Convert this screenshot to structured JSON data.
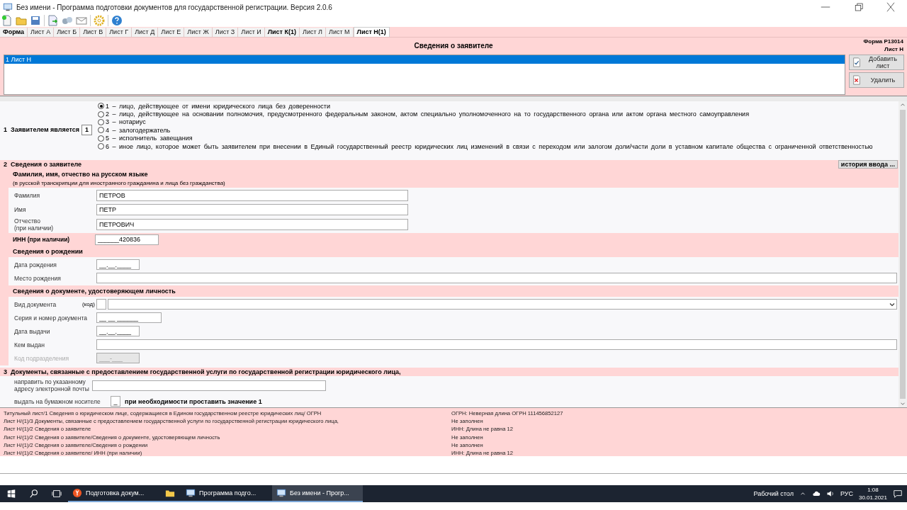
{
  "window": {
    "title": "Без имени - Программа подготовки документов для государственной регистрации. Версия 2.0.6"
  },
  "tabs": [
    {
      "label": "Форма",
      "bold": true,
      "selected": false
    },
    {
      "label": "Лист А",
      "bold": false,
      "selected": false
    },
    {
      "label": "Лист Б",
      "bold": false,
      "selected": false
    },
    {
      "label": "Лист В",
      "bold": false,
      "selected": false
    },
    {
      "label": "Лист Г",
      "bold": false,
      "selected": false
    },
    {
      "label": "Лист Д",
      "bold": false,
      "selected": false
    },
    {
      "label": "Лист Е",
      "bold": false,
      "selected": false
    },
    {
      "label": "Лист Ж",
      "bold": false,
      "selected": false
    },
    {
      "label": "Лист З",
      "bold": false,
      "selected": false
    },
    {
      "label": "Лист И",
      "bold": false,
      "selected": false
    },
    {
      "label": "Лист К(1)",
      "bold": true,
      "selected": false
    },
    {
      "label": "Лист Л",
      "bold": false,
      "selected": false
    },
    {
      "label": "Лист М",
      "bold": false,
      "selected": false
    },
    {
      "label": "Лист Н(1)",
      "bold": true,
      "selected": true
    }
  ],
  "header": {
    "title": "Сведения о заявителе",
    "form_code": "Форма Р13014",
    "sheet": "Лист Н"
  },
  "sheets": {
    "items": [
      {
        "label": "1 Лист Н",
        "selected": true
      }
    ],
    "buttons": [
      {
        "label": "Добавить лист",
        "kind": "add"
      },
      {
        "label": "Удалить",
        "kind": "delete"
      }
    ]
  },
  "section1": {
    "number": "1",
    "label": "Заявителем является",
    "code": "1",
    "options": [
      {
        "label": "1 – лицо, действующее от имени юридического лица без доверенности",
        "selected": true
      },
      {
        "label": "2 – лицо, действующее на основании полномочия, предусмотренного федеральным законом, актом специально уполномоченного на то государственного органа или актом органа местного самоуправления",
        "selected": false
      },
      {
        "label": "3 – нотариус",
        "selected": false
      },
      {
        "label": "4 – залогодержатель",
        "selected": false
      },
      {
        "label": "5 – исполнитель завещания",
        "selected": false
      },
      {
        "label": "6 – иное лицо, которое может быть заявителем при внесении в Единый государственный реестр юридических лиц изменений в связи с переходом или залогом доли/части доли в уставном капитале общества с ограниченной ответственностью",
        "selected": false
      }
    ]
  },
  "section2": {
    "number": "2",
    "title": "Сведения о заявителе",
    "history_button": "история ввода ...",
    "name_heading": "Фамилия, имя, отчество на русском языке",
    "name_note": "(в русской транскрипции для иностранного гражданина и лица без гражданства)",
    "name_fields": [
      {
        "label": "Фамилия",
        "value": "ПЕТРОВ"
      },
      {
        "label": "Имя",
        "value": "ПЕТР"
      },
      {
        "label": "Отчество",
        "note": "(при наличии)",
        "value": "ПЕТРОВИЧ"
      }
    ],
    "inn": {
      "label": "ИНН (при наличии)",
      "value": "______420836"
    },
    "birth": {
      "heading": "Сведения о рождении",
      "fields": [
        {
          "label": "Дата рождения",
          "value": "__.__.____",
          "kind": "short",
          "disabled": false
        },
        {
          "label": "Место рождения",
          "kind": "wide",
          "disabled": false
        }
      ]
    },
    "document": {
      "heading": "Сведения о документе, удостоверяющем личность",
      "fields": [
        {
          "label": "Вид документа",
          "kind": "combo",
          "code_label": "(код)",
          "disabled": false
        },
        {
          "label": "Серия и номер документа",
          "value": "__ __ ______",
          "kind": "medium",
          "disabled": false
        },
        {
          "label": "Дата выдачи",
          "value": "__.__.____",
          "kind": "short",
          "disabled": false
        },
        {
          "label": "Кем выдан",
          "kind": "wide",
          "disabled": false
        },
        {
          "label": "Код подразделения",
          "value": "___-___",
          "kind": "short",
          "disabled": true
        }
      ]
    }
  },
  "section3": {
    "number": "3",
    "title": "Документы, связанные с предоставлением государственной услуги по государственной регистрации юридического лица,",
    "email_label": "направить по указанному адресу электронной почты",
    "paper_label": "выдать на бумажном носителе",
    "paper_value": "_",
    "paper_hint": "при необходимости проставить значение 1"
  },
  "errors": [
    {
      "place": "Титульный лист/1 Сведения о юридическом лице, содержащиеся в Едином государственном реестре юридических лиц/ ОГРН",
      "message": "ОГРН:  Неверная длина ОГРН 111456852127"
    },
    {
      "place": "Лист Н/(1)/3 Документы, связанные с предоставлением государственной услуги по государственной регистрации юридического лица,",
      "message": "Не заполнен"
    },
    {
      "place": "Лист Н/(1)/2 Сведения о заявителе",
      "message": "ИНН: Длина не равна 12"
    },
    {
      "place": "Лист Н/(1)/2 Сведения о заявителе/Сведения о документе, удостоверяющем личность",
      "message": "Не заполнен"
    },
    {
      "place": "Лист Н/(1)/2 Сведения о заявителе/Сведения о рождении",
      "message": "Не заполнен"
    },
    {
      "place": "Лист Н/(1)/2 Сведения о заявителе/ ИНН (при наличии)",
      "message": "ИНН: Длина не равна 12"
    }
  ],
  "taskbar": {
    "apps": [
      {
        "label": "Подготовка докум...",
        "kind": "browser",
        "active": false
      },
      {
        "kind": "explorer",
        "active": false
      },
      {
        "label": "Программа подго...",
        "kind": "program",
        "active": false
      },
      {
        "label": "Без имени - Прогр...",
        "kind": "program",
        "active": true
      }
    ],
    "desktop_label": "Рабочий стол",
    "language": "РУС",
    "time": "1:08",
    "date": "30.01.2021"
  }
}
